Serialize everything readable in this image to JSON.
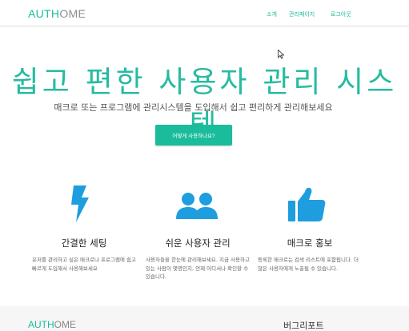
{
  "brand": {
    "part1": "AUTH",
    "part2": "OME"
  },
  "nav": {
    "items": [
      "소개",
      "관리페이지",
      "로그아웃"
    ]
  },
  "hero": {
    "title": "쉽고 편한 사용자 관리 시스템",
    "subtitle": "매크로 또는 프로그램에 관리시스템을 도입해서 쉽고 편리하게 관리해보세요",
    "cta_label": "어떻게 사용하나요?"
  },
  "features": [
    {
      "icon": "lightning-bolt-icon",
      "title": "간결한 세팅",
      "desc": "유저를 관리하고 싶은 매크로나 프로그램에 쉽고 빠르게 도입해서 사용해보세요"
    },
    {
      "icon": "users-icon",
      "title": "쉬운 사용자 관리",
      "desc": "사용자들을 한눈에 관리해보세요. 지금 사용하고 있는 사람이 몇명인지, 언제 어디서나 확인할 수 있습니다."
    },
    {
      "icon": "thumbs-up-icon",
      "title": "매크로 홍보",
      "desc": "등록한 매크로는 검색 리스트에 포함됩니다. 더 많은 사용자에게 노출될 수 있습니다."
    }
  ],
  "footer": {
    "brand_part1": "AUTH",
    "brand_part2": "OME",
    "report_label": "버그리포트"
  },
  "colors": {
    "accent": "#1abc9c",
    "icon": "#1e9ede",
    "footer_bg": "#f6f6f6"
  }
}
